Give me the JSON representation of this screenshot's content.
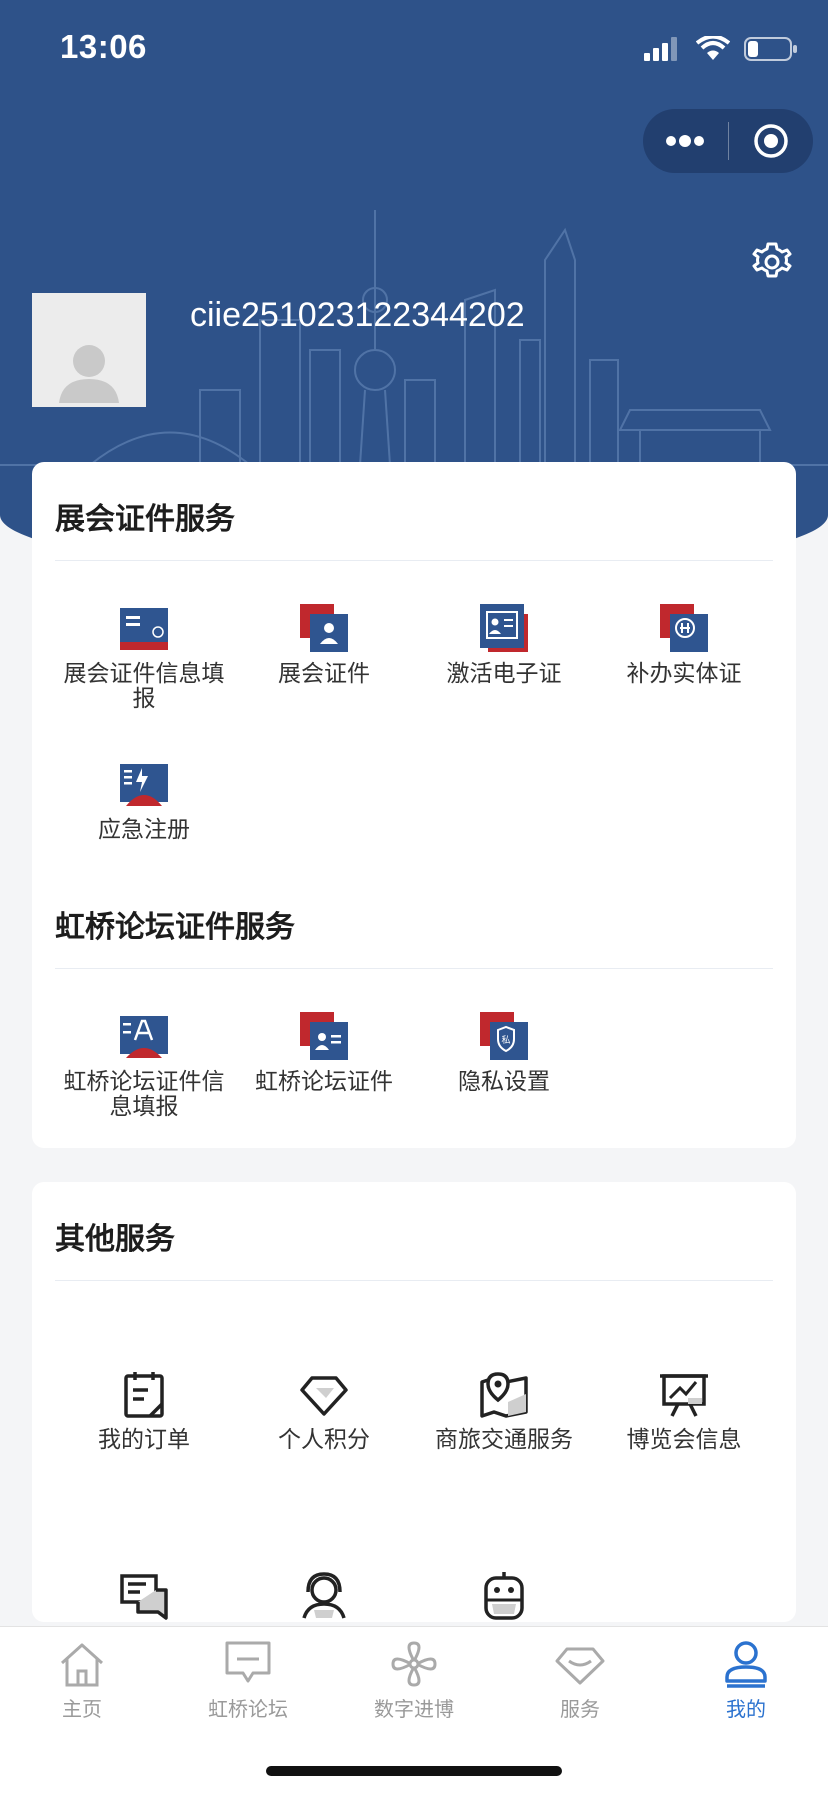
{
  "status_bar": {
    "time": "13:06"
  },
  "header": {
    "username": "ciie251023122344202"
  },
  "sections": {
    "badge_services": {
      "title": "展会证件服务",
      "items": [
        {
          "label": "展会证件信息填报",
          "icon": "badge-form-icon"
        },
        {
          "label": "展会证件",
          "icon": "badge-card-icon"
        },
        {
          "label": "激活电子证",
          "icon": "activate-e-badge-icon"
        },
        {
          "label": "补办实体证",
          "icon": "reissue-badge-icon"
        },
        {
          "label": "应急注册",
          "icon": "emergency-register-icon"
        }
      ]
    },
    "forum_services": {
      "title": "虹桥论坛证件服务",
      "items": [
        {
          "label": "虹桥论坛证件信息填报",
          "icon": "forum-badge-form-icon"
        },
        {
          "label": "虹桥论坛证件",
          "icon": "forum-badge-icon"
        },
        {
          "label": "隐私设置",
          "icon": "privacy-icon"
        }
      ]
    },
    "other_services": {
      "title": "其他服务",
      "items": [
        {
          "label": "我的订单",
          "icon": "orders-icon"
        },
        {
          "label": "个人积分",
          "icon": "points-icon"
        },
        {
          "label": "商旅交通服务",
          "icon": "travel-map-icon"
        },
        {
          "label": "博览会信息",
          "icon": "presentation-icon"
        },
        {
          "label": "",
          "icon": "feedback-icon"
        },
        {
          "label": "",
          "icon": "customer-service-icon"
        },
        {
          "label": "",
          "icon": "robot-icon"
        }
      ]
    }
  },
  "tabbar": {
    "tabs": [
      {
        "label": "主页",
        "icon": "home-icon",
        "active": false
      },
      {
        "label": "虹桥论坛",
        "icon": "forum-icon",
        "active": false
      },
      {
        "label": "数字进博",
        "icon": "flower-icon",
        "active": false
      },
      {
        "label": "服务",
        "icon": "service-diamond-icon",
        "active": false
      },
      {
        "label": "我的",
        "icon": "person-icon",
        "active": true
      }
    ]
  },
  "colors": {
    "header_bg": "#2e5289",
    "brand_blue": "#2f5590",
    "brand_red": "#c0282d",
    "active_tab": "#2b72cf",
    "inactive_tab": "#9a9a9a"
  }
}
